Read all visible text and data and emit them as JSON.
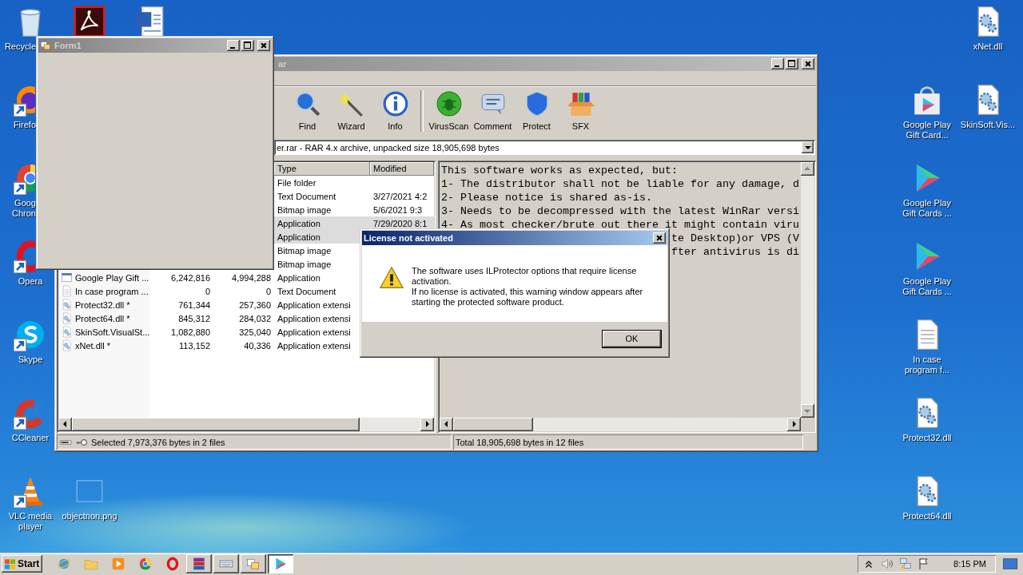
{
  "desktop": {
    "icons": [
      {
        "label": "Recycle",
        "kind": "recycle",
        "shortcut": false
      },
      {
        "kind": "acrobat",
        "shortcut": false
      },
      {
        "kind": "word",
        "shortcut": false
      },
      {
        "label": "Firefo",
        "kind": "firefox",
        "shortcut": true
      },
      {
        "label": "Goog Chron",
        "kind": "chrome",
        "shortcut": true
      },
      {
        "label": "Opera",
        "kind": "opera",
        "shortcut": true
      },
      {
        "label": "Skype",
        "kind": "skype",
        "shortcut": true
      },
      {
        "label": "CCleaner",
        "kind": "ccleaner",
        "shortcut": true
      },
      {
        "label": "VLC media player",
        "kind": "vlc",
        "shortcut": true
      },
      {
        "label": "objectnon.png",
        "kind": "image",
        "shortcut": false
      },
      {
        "label": "xNet.dll",
        "kind": "dll",
        "shortcut": false
      },
      {
        "label": "Google Play Gift Card...",
        "kind": "playbag",
        "shortcut": false
      },
      {
        "label": "SkinSoft.Vis...",
        "kind": "dll",
        "shortcut": false
      },
      {
        "label": "Google Play Gift Cards ...",
        "kind": "play",
        "shortcut": false
      },
      {
        "label": "Google Play Gift Cards ...",
        "kind": "play",
        "shortcut": false
      },
      {
        "label": "In case program f...",
        "kind": "text",
        "shortcut": false
      },
      {
        "label": "Protect32.dll",
        "kind": "dll",
        "shortcut": false
      },
      {
        "label": "Protect64.dll",
        "kind": "dll",
        "shortcut": false
      }
    ]
  },
  "archive_window": {
    "title": "ar",
    "toolbar": [
      {
        "label": "Find",
        "kind": "find"
      },
      {
        "label": "Wizard",
        "kind": "wizard"
      },
      {
        "label": "Info",
        "kind": "info"
      },
      {
        "label": "VirusScan",
        "kind": "virusscan"
      },
      {
        "label": "Comment",
        "kind": "comment"
      },
      {
        "label": "Protect",
        "kind": "protect"
      },
      {
        "label": "SFX",
        "kind": "sfx"
      }
    ],
    "path": "er.rar - RAR 4.x archive, unpacked size 18,905,698 bytes",
    "columns": [
      "Type",
      "Modified"
    ],
    "rows": [
      {
        "type": "File folder",
        "selected": false
      },
      {
        "type": "Text Document",
        "modified": "3/27/2021 4:2",
        "selected": false
      },
      {
        "type": "Bitmap image",
        "modified": "5/6/2021 9:3",
        "selected": false
      },
      {
        "type": "Application",
        "modified": "7/29/2020 8:1",
        "selected": true
      },
      {
        "type": "Application",
        "selected": true
      },
      {
        "type": "Bitmap image",
        "selected": false
      },
      {
        "type": "Bitmap image",
        "selected": false
      },
      {
        "name": "Google Play Gift ...",
        "kind": "app",
        "size": "6,242,816",
        "packed": "4,994,288",
        "type": "Application",
        "selected": false
      },
      {
        "name": "In case program ...",
        "kind": "text",
        "size": "0",
        "packed": "0",
        "type": "Text Document",
        "selected": false
      },
      {
        "name": "Protect32.dll *",
        "kind": "dll",
        "size": "761,344",
        "packed": "257,360",
        "type": "Application extensi",
        "selected": false
      },
      {
        "name": "Protect64.dll *",
        "kind": "dll",
        "size": "845,312",
        "packed": "284,032",
        "type": "Application extensi",
        "selected": false
      },
      {
        "name": "SkinSoft.VisualSt...",
        "kind": "dll",
        "size": "1,082,880",
        "packed": "325,040",
        "type": "Application extensi",
        "selected": false
      },
      {
        "name": "xNet.dll *",
        "kind": "dll",
        "size": "113,152",
        "packed": "40,336",
        "type": "Application extensi",
        "selected": false
      }
    ],
    "comment_lines": [
      "This software works as expected, but:",
      "1- The distributor shall not be liable for any damage, d",
      "2- Please notice is shared as-is.",
      "3- Needs to be decompressed with the latest WinRar versi",
      "4- As most checker/brute out there it might contain viru"
    ],
    "comment_line_tails": [
      "te Desktop)or VPS (V",
      "fter antivirus is di"
    ],
    "status_left": "Selected 7,973,376 bytes in 2 files",
    "status_right": "Total 18,905,698 bytes in 12 files"
  },
  "form_window": {
    "title": "Form1"
  },
  "dialog": {
    "title": "License not activated",
    "message": [
      "The software uses ILProtector options that require license activation.",
      "If no license is activated, this warning window appears after starting the protected software product."
    ],
    "button": "OK"
  },
  "taskbar": {
    "start": "Start",
    "quick_launch": [
      {
        "kind": "ie"
      },
      {
        "kind": "folder"
      },
      {
        "kind": "wmp"
      },
      {
        "kind": "chrome"
      },
      {
        "kind": "opera"
      }
    ],
    "tasks": [
      {
        "kind": "winrar",
        "selected": false
      },
      {
        "kind": "keyboard",
        "selected": false
      },
      {
        "kind": "form",
        "selected": false
      },
      {
        "kind": "play",
        "selected": true
      }
    ],
    "tray": [
      {
        "kind": "chevron"
      },
      {
        "kind": "speaker"
      },
      {
        "kind": "network"
      },
      {
        "kind": "flag"
      }
    ],
    "clock": "8:15 PM"
  }
}
